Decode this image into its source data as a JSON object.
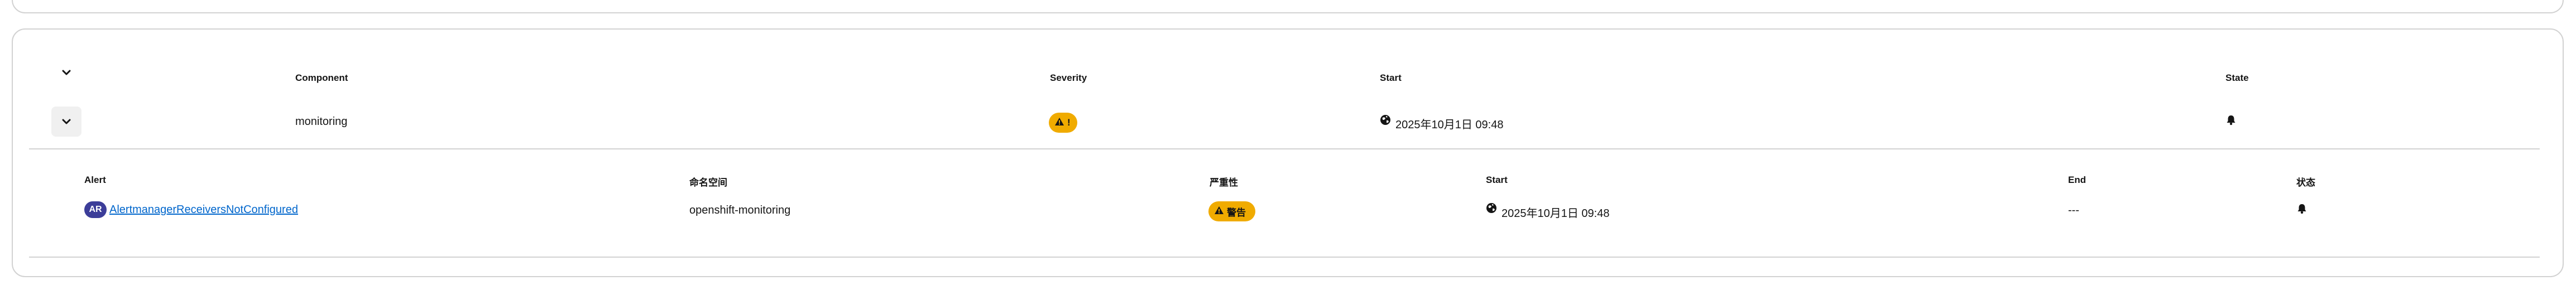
{
  "outer_table": {
    "headers": {
      "component": "Component",
      "severity": "Severity",
      "start": "Start",
      "state": "State"
    },
    "row": {
      "component": "monitoring",
      "severity_badge": "!",
      "start": "2025年10月1日 09:48"
    }
  },
  "alerts_table": {
    "headers": {
      "alert": "Alert",
      "namespace": "命名空间",
      "severity": "严重性",
      "start": "Start",
      "end": "End",
      "state": "状态"
    },
    "rows": [
      {
        "badge": "AR",
        "alert_name": "AlertmanagerReceiversNotConfigured",
        "namespace": "openshift-monitoring",
        "severity": "警告",
        "start": "2025年10月1日 09:48",
        "end": "---"
      }
    ]
  },
  "colors": {
    "warning": "#f0ab00",
    "link": "#0066cc",
    "alert_rule_badge": "#3c3d99",
    "border": "#d2d2d2"
  },
  "icons": {
    "expand_all": "chevron-down-icon",
    "row_toggle": "chevron-down-icon",
    "severity": "warning-triangle-icon",
    "start": "globe-icon",
    "state": "bell-icon"
  }
}
